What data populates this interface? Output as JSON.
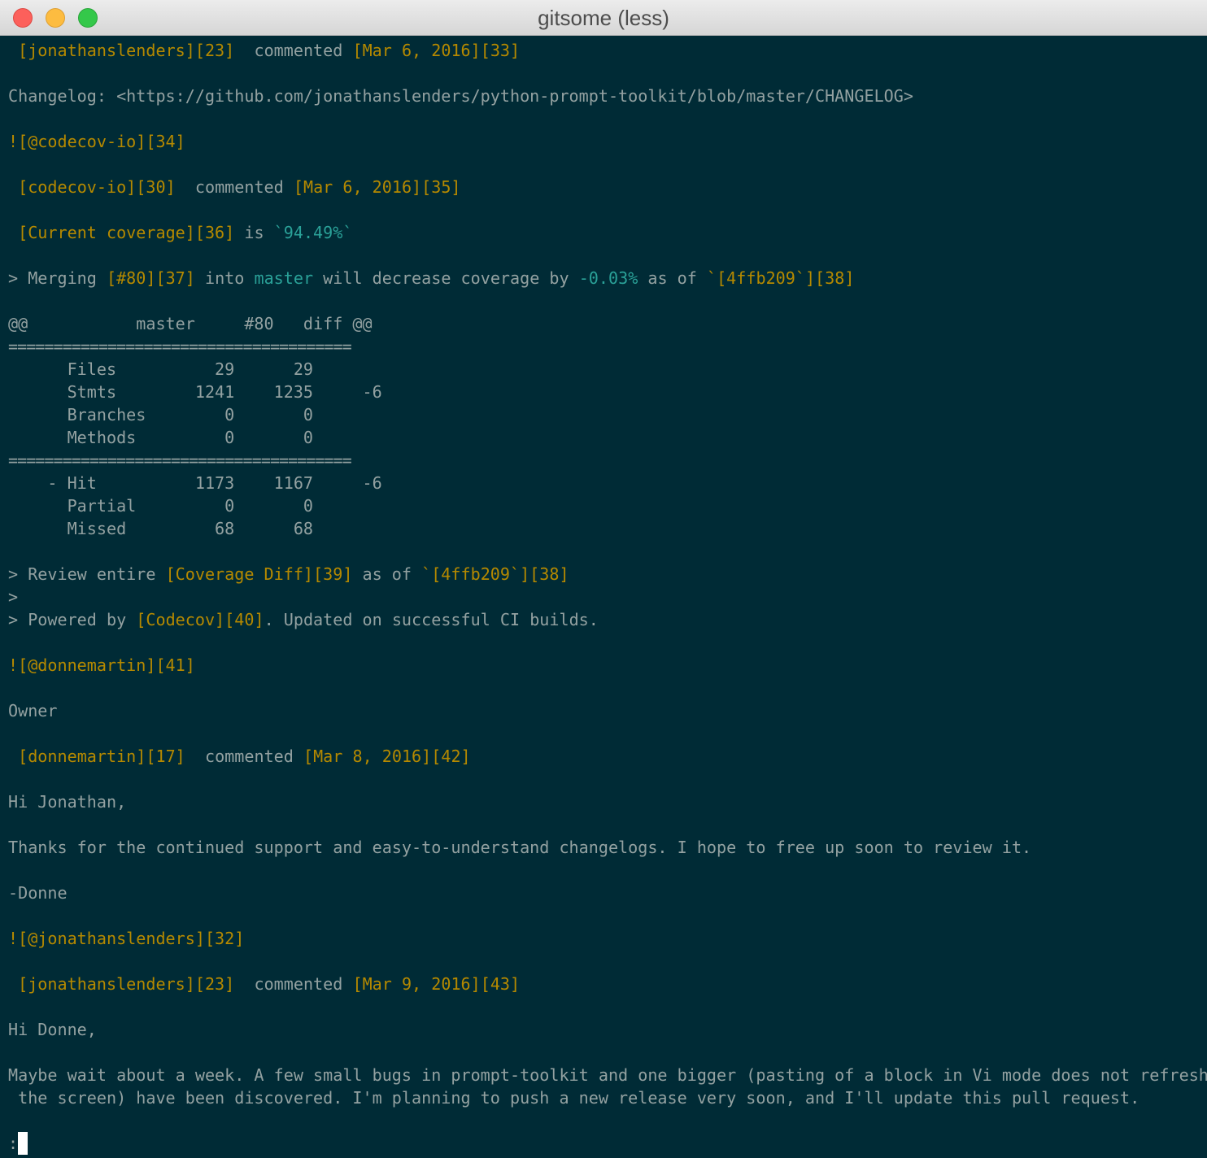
{
  "window": {
    "title": "gitsome (less)"
  },
  "lines": {
    "l1": {
      "user": "[jonathanslenders][23]",
      "verb": "commented",
      "date": "[Mar 6, 2016][33]"
    },
    "l2": {
      "text": "Changelog: <https://github.com/jonathanslenders/python-prompt-toolkit/blob/master/CHANGELOG>"
    },
    "l3": {
      "text": "![@codecov-io][34]"
    },
    "l4": {
      "user": "[codecov-io][30]",
      "verb": "commented",
      "date": "[Mar 6, 2016][35]"
    },
    "l5": {
      "link": "[Current coverage][36]",
      "mid": " is ",
      "code": "`94.49%`"
    },
    "l6": {
      "p1": "> Merging ",
      "p2": "[#80][37]",
      "p3": " into ",
      "p4": "master",
      "p5": " will decrease coverage by ",
      "p6": "-0.03%",
      "p7": " as of ",
      "p8": "`[4ffb209`][38]"
    },
    "t_header": "@@           master     #80   diff @@",
    "t_rule1": "======================================",
    "t_files": "      Files          29      29",
    "t_stmts": "      Stmts        1241    1235     -6",
    "t_branches": "      Branches        0       0",
    "t_methods": "      Methods         0       0",
    "t_rule2": "======================================",
    "t_hit": "    - Hit          1173    1167     -6",
    "t_partial": "      Partial         0       0",
    "t_missed": "      Missed         68      68",
    "l7": {
      "p1": "> Review entire ",
      "p2": "[Coverage Diff][39]",
      "p3": " as of ",
      "p4": "`[4ffb209`][38]"
    },
    "l8": {
      "text": ">"
    },
    "l9": {
      "p1": "> Powered by ",
      "p2": "[Codecov][40]",
      "p3": ". Updated on successful CI builds."
    },
    "l10": {
      "text": "![@donnemartin][41]"
    },
    "l11": {
      "text": "Owner"
    },
    "l12": {
      "user": "[donnemartin][17]",
      "verb": "commented",
      "date": "[Mar 8, 2016][42]"
    },
    "l13": {
      "text": "Hi Jonathan,"
    },
    "l14": {
      "text": "Thanks for the continued support and easy-to-understand changelogs. I hope to free up soon to review it."
    },
    "l15": {
      "text": "-Donne"
    },
    "l16": {
      "text": "![@jonathanslenders][32]"
    },
    "l17": {
      "user": "[jonathanslenders][23]",
      "verb": "commented",
      "date": "[Mar 9, 2016][43]"
    },
    "l18": {
      "text": "Hi Donne,"
    },
    "l19": {
      "text": "Maybe wait about a week. A few small bugs in prompt-toolkit and one bigger (pasting of a block in Vi mode does not refresh"
    },
    "l20": {
      "text": " the screen) have been discovered. I'm planning to push a new release very soon, and I'll update this pull request."
    },
    "prompt": ":"
  },
  "colors": {
    "background": "#002b36",
    "text": "#93a1a1",
    "link": "#b58900",
    "code": "#2aa198"
  }
}
